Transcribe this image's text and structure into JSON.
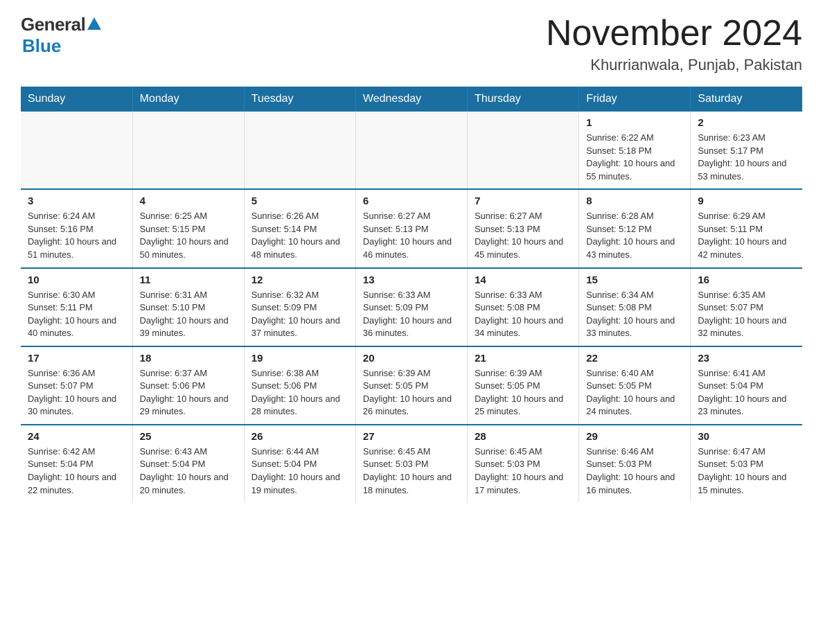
{
  "header": {
    "logo_general": "General",
    "logo_blue": "Blue",
    "month_title": "November 2024",
    "location": "Khurrianwala, Punjab, Pakistan"
  },
  "days_of_week": [
    "Sunday",
    "Monday",
    "Tuesday",
    "Wednesday",
    "Thursday",
    "Friday",
    "Saturday"
  ],
  "weeks": [
    [
      {
        "day": "",
        "info": ""
      },
      {
        "day": "",
        "info": ""
      },
      {
        "day": "",
        "info": ""
      },
      {
        "day": "",
        "info": ""
      },
      {
        "day": "",
        "info": ""
      },
      {
        "day": "1",
        "info": "Sunrise: 6:22 AM\nSunset: 5:18 PM\nDaylight: 10 hours and 55 minutes."
      },
      {
        "day": "2",
        "info": "Sunrise: 6:23 AM\nSunset: 5:17 PM\nDaylight: 10 hours and 53 minutes."
      }
    ],
    [
      {
        "day": "3",
        "info": "Sunrise: 6:24 AM\nSunset: 5:16 PM\nDaylight: 10 hours and 51 minutes."
      },
      {
        "day": "4",
        "info": "Sunrise: 6:25 AM\nSunset: 5:15 PM\nDaylight: 10 hours and 50 minutes."
      },
      {
        "day": "5",
        "info": "Sunrise: 6:26 AM\nSunset: 5:14 PM\nDaylight: 10 hours and 48 minutes."
      },
      {
        "day": "6",
        "info": "Sunrise: 6:27 AM\nSunset: 5:13 PM\nDaylight: 10 hours and 46 minutes."
      },
      {
        "day": "7",
        "info": "Sunrise: 6:27 AM\nSunset: 5:13 PM\nDaylight: 10 hours and 45 minutes."
      },
      {
        "day": "8",
        "info": "Sunrise: 6:28 AM\nSunset: 5:12 PM\nDaylight: 10 hours and 43 minutes."
      },
      {
        "day": "9",
        "info": "Sunrise: 6:29 AM\nSunset: 5:11 PM\nDaylight: 10 hours and 42 minutes."
      }
    ],
    [
      {
        "day": "10",
        "info": "Sunrise: 6:30 AM\nSunset: 5:11 PM\nDaylight: 10 hours and 40 minutes."
      },
      {
        "day": "11",
        "info": "Sunrise: 6:31 AM\nSunset: 5:10 PM\nDaylight: 10 hours and 39 minutes."
      },
      {
        "day": "12",
        "info": "Sunrise: 6:32 AM\nSunset: 5:09 PM\nDaylight: 10 hours and 37 minutes."
      },
      {
        "day": "13",
        "info": "Sunrise: 6:33 AM\nSunset: 5:09 PM\nDaylight: 10 hours and 36 minutes."
      },
      {
        "day": "14",
        "info": "Sunrise: 6:33 AM\nSunset: 5:08 PM\nDaylight: 10 hours and 34 minutes."
      },
      {
        "day": "15",
        "info": "Sunrise: 6:34 AM\nSunset: 5:08 PM\nDaylight: 10 hours and 33 minutes."
      },
      {
        "day": "16",
        "info": "Sunrise: 6:35 AM\nSunset: 5:07 PM\nDaylight: 10 hours and 32 minutes."
      }
    ],
    [
      {
        "day": "17",
        "info": "Sunrise: 6:36 AM\nSunset: 5:07 PM\nDaylight: 10 hours and 30 minutes."
      },
      {
        "day": "18",
        "info": "Sunrise: 6:37 AM\nSunset: 5:06 PM\nDaylight: 10 hours and 29 minutes."
      },
      {
        "day": "19",
        "info": "Sunrise: 6:38 AM\nSunset: 5:06 PM\nDaylight: 10 hours and 28 minutes."
      },
      {
        "day": "20",
        "info": "Sunrise: 6:39 AM\nSunset: 5:05 PM\nDaylight: 10 hours and 26 minutes."
      },
      {
        "day": "21",
        "info": "Sunrise: 6:39 AM\nSunset: 5:05 PM\nDaylight: 10 hours and 25 minutes."
      },
      {
        "day": "22",
        "info": "Sunrise: 6:40 AM\nSunset: 5:05 PM\nDaylight: 10 hours and 24 minutes."
      },
      {
        "day": "23",
        "info": "Sunrise: 6:41 AM\nSunset: 5:04 PM\nDaylight: 10 hours and 23 minutes."
      }
    ],
    [
      {
        "day": "24",
        "info": "Sunrise: 6:42 AM\nSunset: 5:04 PM\nDaylight: 10 hours and 22 minutes."
      },
      {
        "day": "25",
        "info": "Sunrise: 6:43 AM\nSunset: 5:04 PM\nDaylight: 10 hours and 20 minutes."
      },
      {
        "day": "26",
        "info": "Sunrise: 6:44 AM\nSunset: 5:04 PM\nDaylight: 10 hours and 19 minutes."
      },
      {
        "day": "27",
        "info": "Sunrise: 6:45 AM\nSunset: 5:03 PM\nDaylight: 10 hours and 18 minutes."
      },
      {
        "day": "28",
        "info": "Sunrise: 6:45 AM\nSunset: 5:03 PM\nDaylight: 10 hours and 17 minutes."
      },
      {
        "day": "29",
        "info": "Sunrise: 6:46 AM\nSunset: 5:03 PM\nDaylight: 10 hours and 16 minutes."
      },
      {
        "day": "30",
        "info": "Sunrise: 6:47 AM\nSunset: 5:03 PM\nDaylight: 10 hours and 15 minutes."
      }
    ]
  ]
}
